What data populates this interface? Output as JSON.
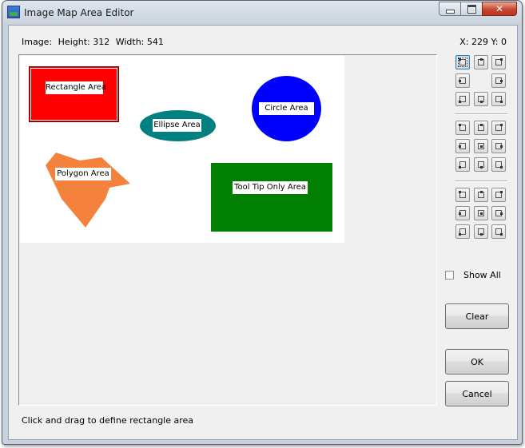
{
  "window": {
    "title": "Image Map Area Editor",
    "caption": {
      "minimize": "",
      "maximize": "",
      "close": "✕"
    }
  },
  "image_info": {
    "label": "Image:",
    "height": "Height: 312",
    "width": "Width: 541"
  },
  "coords": "X: 229  Y: 0",
  "areas": {
    "rectangle": {
      "label": "Rectangle Area",
      "color": "#ff0000"
    },
    "ellipse": {
      "label": "Ellipse Area",
      "color": "#008080"
    },
    "circle": {
      "label": "Circle Area",
      "color": "#0000ff"
    },
    "polygon": {
      "label": "Polygon Area",
      "color": "#f4823c"
    },
    "tooltip": {
      "label": "Tool Tip Only Area",
      "color": "#008000"
    }
  },
  "tool_groups": [
    {
      "name": "resize-handles",
      "icons": [
        "resize-top-left-icon",
        "resize-top-icon",
        "resize-top-right-icon",
        "resize-left-icon",
        "resize-right-icon",
        "resize-bottom-left-icon",
        "resize-bottom-icon",
        "resize-bottom-right-icon"
      ]
    },
    {
      "name": "align",
      "icons": [
        "align-top-left-icon",
        "align-top-icon",
        "align-top-right-icon",
        "align-left-icon",
        "align-center-icon",
        "align-right-icon",
        "align-bottom-left-icon",
        "align-bottom-icon",
        "align-bottom-right-icon"
      ]
    },
    {
      "name": "move",
      "icons": [
        "move-up-left-icon",
        "move-up-icon",
        "move-up-right-icon",
        "move-left-icon",
        "move-center-icon",
        "move-right-icon",
        "move-down-left-icon",
        "move-down-icon",
        "move-down-right-icon"
      ]
    }
  ],
  "show_all": {
    "label": "Show All",
    "checked": false
  },
  "buttons": {
    "clear": "Clear",
    "ok": "OK",
    "cancel": "Cancel"
  },
  "status": "Click and drag to define rectangle area"
}
